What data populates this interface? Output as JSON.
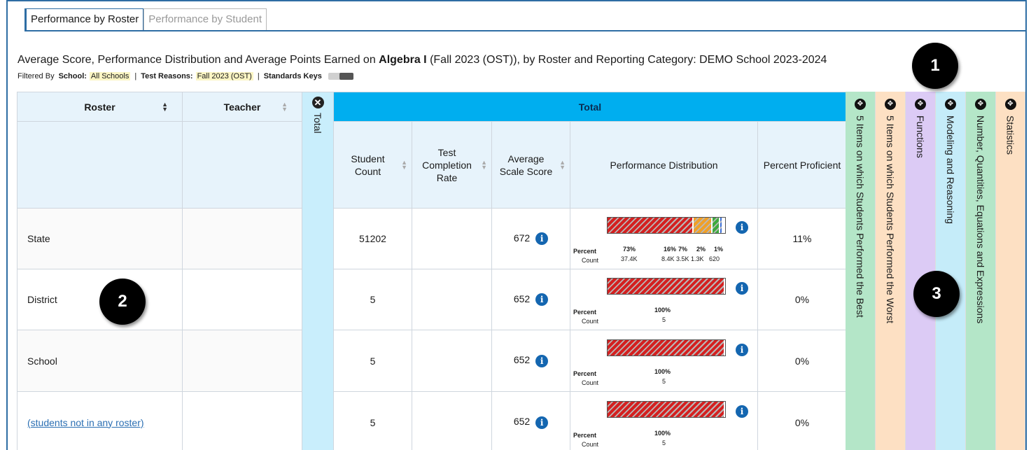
{
  "tabs": [
    {
      "label": "Performance by Roster",
      "active": true
    },
    {
      "label": "Performance by Student",
      "active": false
    }
  ],
  "title": {
    "prefix": "Average Score, Performance Distribution and Average Points Earned on ",
    "subject": "Algebra I",
    "suffix": " (Fall 2023 (OST)), by Roster and Reporting Category: DEMO School 2023-2024"
  },
  "filters": {
    "filtered_by": "Filtered By",
    "school_label": "School:",
    "school_value": "All Schools",
    "separator": "|",
    "reasons_label": "Test Reasons:",
    "reasons_value": "Fall 2023 (OST)",
    "keys_label": "Standards Keys"
  },
  "callouts": [
    "1",
    "2",
    "3"
  ],
  "table": {
    "col_roster": "Roster",
    "col_teacher": "Teacher",
    "total_vertical": "Total",
    "total_header": "Total",
    "col_student_count": "Student Count",
    "col_completion": "Test Completion Rate",
    "col_avg_scale": "Average Scale Score",
    "col_perf_dist": "Performance Distribution",
    "col_pct_prof": "Percent Proficient",
    "percent_label": "Percent",
    "count_label": "Count",
    "rows": [
      {
        "roster": "State",
        "teacher": "",
        "count": "51202",
        "completion": "",
        "avg": "672",
        "prof": "11%",
        "dist_pct": [
          "73%",
          "16%",
          "7%",
          "2%",
          "1%"
        ],
        "dist_cnt": [
          "37.4K",
          "8.4K",
          "3.5K",
          "1.3K",
          "620"
        ]
      },
      {
        "roster": "District",
        "teacher": "",
        "count": "5",
        "completion": "",
        "avg": "652",
        "prof": "0%",
        "dist_pct": [
          "100%"
        ],
        "dist_cnt": [
          "5"
        ]
      },
      {
        "roster": "School",
        "teacher": "",
        "count": "5",
        "completion": "",
        "avg": "652",
        "prof": "0%",
        "dist_pct": [
          "100%"
        ],
        "dist_cnt": [
          "5"
        ]
      },
      {
        "roster": "(students not in any roster)",
        "teacher": "",
        "count": "5",
        "completion": "",
        "avg": "652",
        "prof": "0%",
        "dist_pct": [
          "100%"
        ],
        "dist_cnt": [
          "5"
        ]
      }
    ]
  },
  "panels": [
    {
      "label": "5 Items on which Students Performed the Best",
      "color": "#b4e6c8"
    },
    {
      "label": "5 Items on which Students Performed the Worst",
      "color": "#fde0c3"
    },
    {
      "label": "Functions",
      "color": "#dccbf5"
    },
    {
      "label": "Modeling and Reasoning",
      "color": "#c5ecf9"
    },
    {
      "label": "Number, Quantities, Equations and Expressions",
      "color": "#b4e6c8"
    },
    {
      "label": "Statistics",
      "color": "#fde0c3"
    }
  ],
  "colors": {
    "level1": "#d42020",
    "level2": "#f0a028",
    "level3": "#3daa3d",
    "level4": "#3c6fd6",
    "level5": "#8c3bd8",
    "accent": "#2e6da4",
    "header_blue": "#00aeef"
  },
  "icons": {
    "info": "info-circle-icon",
    "close": "close-circle-icon",
    "expand": "expand-arrows-icon",
    "sort": "sort-arrows-icon"
  }
}
